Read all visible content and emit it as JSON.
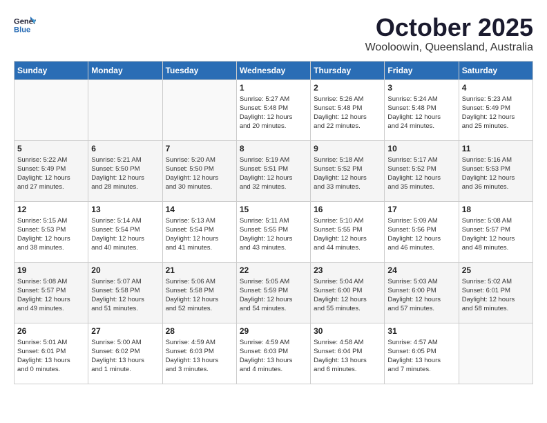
{
  "logo": {
    "line1": "General",
    "line2": "Blue"
  },
  "title": "October 2025",
  "subtitle": "Wooloowin, Queensland, Australia",
  "weekdays": [
    "Sunday",
    "Monday",
    "Tuesday",
    "Wednesday",
    "Thursday",
    "Friday",
    "Saturday"
  ],
  "weeks": [
    [
      {
        "day": "",
        "info": ""
      },
      {
        "day": "",
        "info": ""
      },
      {
        "day": "",
        "info": ""
      },
      {
        "day": "1",
        "info": "Sunrise: 5:27 AM\nSunset: 5:48 PM\nDaylight: 12 hours\nand 20 minutes."
      },
      {
        "day": "2",
        "info": "Sunrise: 5:26 AM\nSunset: 5:48 PM\nDaylight: 12 hours\nand 22 minutes."
      },
      {
        "day": "3",
        "info": "Sunrise: 5:24 AM\nSunset: 5:48 PM\nDaylight: 12 hours\nand 24 minutes."
      },
      {
        "day": "4",
        "info": "Sunrise: 5:23 AM\nSunset: 5:49 PM\nDaylight: 12 hours\nand 25 minutes."
      }
    ],
    [
      {
        "day": "5",
        "info": "Sunrise: 5:22 AM\nSunset: 5:49 PM\nDaylight: 12 hours\nand 27 minutes."
      },
      {
        "day": "6",
        "info": "Sunrise: 5:21 AM\nSunset: 5:50 PM\nDaylight: 12 hours\nand 28 minutes."
      },
      {
        "day": "7",
        "info": "Sunrise: 5:20 AM\nSunset: 5:50 PM\nDaylight: 12 hours\nand 30 minutes."
      },
      {
        "day": "8",
        "info": "Sunrise: 5:19 AM\nSunset: 5:51 PM\nDaylight: 12 hours\nand 32 minutes."
      },
      {
        "day": "9",
        "info": "Sunrise: 5:18 AM\nSunset: 5:52 PM\nDaylight: 12 hours\nand 33 minutes."
      },
      {
        "day": "10",
        "info": "Sunrise: 5:17 AM\nSunset: 5:52 PM\nDaylight: 12 hours\nand 35 minutes."
      },
      {
        "day": "11",
        "info": "Sunrise: 5:16 AM\nSunset: 5:53 PM\nDaylight: 12 hours\nand 36 minutes."
      }
    ],
    [
      {
        "day": "12",
        "info": "Sunrise: 5:15 AM\nSunset: 5:53 PM\nDaylight: 12 hours\nand 38 minutes."
      },
      {
        "day": "13",
        "info": "Sunrise: 5:14 AM\nSunset: 5:54 PM\nDaylight: 12 hours\nand 40 minutes."
      },
      {
        "day": "14",
        "info": "Sunrise: 5:13 AM\nSunset: 5:54 PM\nDaylight: 12 hours\nand 41 minutes."
      },
      {
        "day": "15",
        "info": "Sunrise: 5:11 AM\nSunset: 5:55 PM\nDaylight: 12 hours\nand 43 minutes."
      },
      {
        "day": "16",
        "info": "Sunrise: 5:10 AM\nSunset: 5:55 PM\nDaylight: 12 hours\nand 44 minutes."
      },
      {
        "day": "17",
        "info": "Sunrise: 5:09 AM\nSunset: 5:56 PM\nDaylight: 12 hours\nand 46 minutes."
      },
      {
        "day": "18",
        "info": "Sunrise: 5:08 AM\nSunset: 5:57 PM\nDaylight: 12 hours\nand 48 minutes."
      }
    ],
    [
      {
        "day": "19",
        "info": "Sunrise: 5:08 AM\nSunset: 5:57 PM\nDaylight: 12 hours\nand 49 minutes."
      },
      {
        "day": "20",
        "info": "Sunrise: 5:07 AM\nSunset: 5:58 PM\nDaylight: 12 hours\nand 51 minutes."
      },
      {
        "day": "21",
        "info": "Sunrise: 5:06 AM\nSunset: 5:58 PM\nDaylight: 12 hours\nand 52 minutes."
      },
      {
        "day": "22",
        "info": "Sunrise: 5:05 AM\nSunset: 5:59 PM\nDaylight: 12 hours\nand 54 minutes."
      },
      {
        "day": "23",
        "info": "Sunrise: 5:04 AM\nSunset: 6:00 PM\nDaylight: 12 hours\nand 55 minutes."
      },
      {
        "day": "24",
        "info": "Sunrise: 5:03 AM\nSunset: 6:00 PM\nDaylight: 12 hours\nand 57 minutes."
      },
      {
        "day": "25",
        "info": "Sunrise: 5:02 AM\nSunset: 6:01 PM\nDaylight: 12 hours\nand 58 minutes."
      }
    ],
    [
      {
        "day": "26",
        "info": "Sunrise: 5:01 AM\nSunset: 6:01 PM\nDaylight: 13 hours\nand 0 minutes."
      },
      {
        "day": "27",
        "info": "Sunrise: 5:00 AM\nSunset: 6:02 PM\nDaylight: 13 hours\nand 1 minute."
      },
      {
        "day": "28",
        "info": "Sunrise: 4:59 AM\nSunset: 6:03 PM\nDaylight: 13 hours\nand 3 minutes."
      },
      {
        "day": "29",
        "info": "Sunrise: 4:59 AM\nSunset: 6:03 PM\nDaylight: 13 hours\nand 4 minutes."
      },
      {
        "day": "30",
        "info": "Sunrise: 4:58 AM\nSunset: 6:04 PM\nDaylight: 13 hours\nand 6 minutes."
      },
      {
        "day": "31",
        "info": "Sunrise: 4:57 AM\nSunset: 6:05 PM\nDaylight: 13 hours\nand 7 minutes."
      },
      {
        "day": "",
        "info": ""
      }
    ]
  ]
}
